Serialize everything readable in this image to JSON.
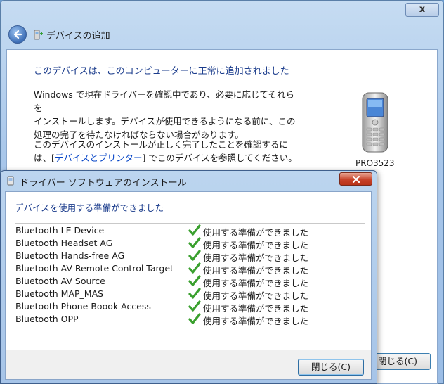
{
  "outer_window": {
    "close_glyph": "x",
    "title": "デバイスの追加",
    "heading": "このデバイスは、このコンピューターに正常に追加されました",
    "para1_line1": "Windows で現在ドライバーを確認中であり、必要に応じてそれらを",
    "para1_line2": "インストールします。デバイスが使用できるようになる前に、この",
    "para1_line3": "処理の完了を待たなければならない場合があります。",
    "para2_line1": "このデバイスのインストールが正しく完了したことを確認するに",
    "para2_prefix": "は、[",
    "para2_link": "デバイスとプリンター",
    "para2_suffix": "] でこのデバイスを参照してください。",
    "device_label": "PRO3523",
    "close_button": "閉じる(C)"
  },
  "driver_dialog": {
    "title": "ドライバー ソフトウェアのインストール",
    "heading": "デバイスを使用する準備ができました",
    "devices": [
      {
        "name": "Bluetooth LE Device",
        "status": "使用する準備ができました"
      },
      {
        "name": "Bluetooth Headset AG",
        "status": "使用する準備ができました"
      },
      {
        "name": "Bluetooth Hands-free AG",
        "status": "使用する準備ができました"
      },
      {
        "name": "Bluetooth AV Remote Control Target",
        "status": "使用する準備ができました"
      },
      {
        "name": "Bluetooth AV Source",
        "status": "使用する準備ができました"
      },
      {
        "name": "Bluetooth MAP_MAS",
        "status": "使用する準備ができました"
      },
      {
        "name": "Bluetooth Phone Boook Access",
        "status": "使用する準備ができました"
      },
      {
        "name": "Bluetooth OPP",
        "status": "使用する準備ができました"
      }
    ],
    "close_button": "閉じる(C)"
  },
  "colors": {
    "heading_blue": "#1b3c8c",
    "link_blue": "#0645c7",
    "check_green": "#3aa02e",
    "close_red": "#c7432a"
  },
  "icons": [
    "back-arrow-icon",
    "bluetooth-device-icon",
    "phone-icon",
    "checkmark-icon",
    "close-x-icon"
  ]
}
